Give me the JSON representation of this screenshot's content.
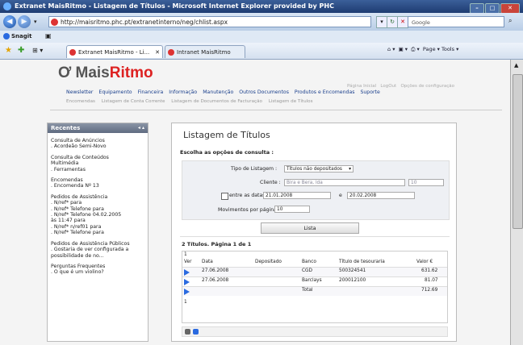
{
  "window": {
    "title": "Extranet MaisRitmo - Listagem de Títulos - Microsoft Internet Explorer provided by PHC"
  },
  "browser": {
    "url": "http://maisritmo.phc.pt/extranetinterno/neg/chlist.aspx",
    "search_placeholder": "Google",
    "links_label": "Snagit",
    "tabs": [
      "Extranet MaisRitmo - Li...",
      "Intranet MaisRitmo"
    ],
    "page_tools": "Page ▾  Tools ▾"
  },
  "site": {
    "logo_mais": "Mais",
    "logo_ritmo": "Ritmo",
    "top_links": [
      "Página Inicial",
      "LogOut",
      "Opções de configuração"
    ],
    "main_nav": [
      "Newsletter",
      "Equipamento",
      "Financeira",
      "Informação",
      "Manutenção",
      "Outros Documentos",
      "Produtos e Encomendas",
      "Suporte"
    ],
    "sub_nav": [
      "Encomendas",
      "Listagem de Conta Corrente",
      "Listagem de Documentos de Facturação",
      "Listagem de Títulos"
    ]
  },
  "sidebar": {
    "title": "Recentes",
    "groups": [
      [
        "Consulta de Anúncios",
        ". Acordeão Semi-Novo"
      ],
      [
        "Consulta de Conteúdos",
        "Multimédia",
        ". Ferramentas"
      ],
      [
        "Encomendas",
        ". Encomenda Nº 13"
      ],
      [
        "Pedidos de Assistência",
        ". N/ref* para",
        ". N/ref* Telefone para",
        ". N/ref* Telefone 04.02.2005",
        "às 11:47 para",
        ". N/ref* n/ref01 para",
        ". N/ref* Telefone para"
      ],
      [
        "Pedidos de Assistência Públicos",
        ". Gostaria de ver configurada a",
        "possibilidade de no..."
      ],
      [
        "Perguntas Frequentes",
        ". O que é um violino?"
      ]
    ]
  },
  "content": {
    "title": "Listagem de Títulos",
    "subtitle": "Escolha as opções de consulta :",
    "form": {
      "tipo_label": "Tipo de Listagem :",
      "tipo_value": "Títulos não depositados",
      "cliente_label": "Cliente :",
      "cliente_value": "Bira e Bera, lda",
      "cliente_no": "10",
      "datas_label": "entre as datas :",
      "date_from": "21.01.2008",
      "e_label": "e",
      "date_to": "20.02.2008",
      "movimentos_label": "Movimentos por página :",
      "movimentos_value": "10"
    },
    "button_lista": "Lista",
    "result_title": "2 Títulos. Página 1 de 1",
    "grid": {
      "page_top": "1",
      "headers": [
        "Ver",
        "Data",
        "Depositado",
        "Banco",
        "Título de tesouraria",
        "Valor €"
      ],
      "rows": [
        {
          "data": "27.06.2008",
          "depositado": "",
          "banco": "CGD",
          "titulo": "500324541",
          "valor": "631.62"
        },
        {
          "data": "27.06.2008",
          "depositado": "",
          "banco": "Barclays",
          "titulo": "200012100",
          "valor": "81.07"
        },
        {
          "data": "",
          "depositado": "",
          "banco": "Total",
          "titulo": "",
          "valor": "712.69"
        }
      ],
      "page_bottom": "1"
    }
  },
  "colors": {
    "accent_red": "#dd2222",
    "link_blue": "#1a3f8c",
    "arrow_blue": "#2a6ae0"
  }
}
